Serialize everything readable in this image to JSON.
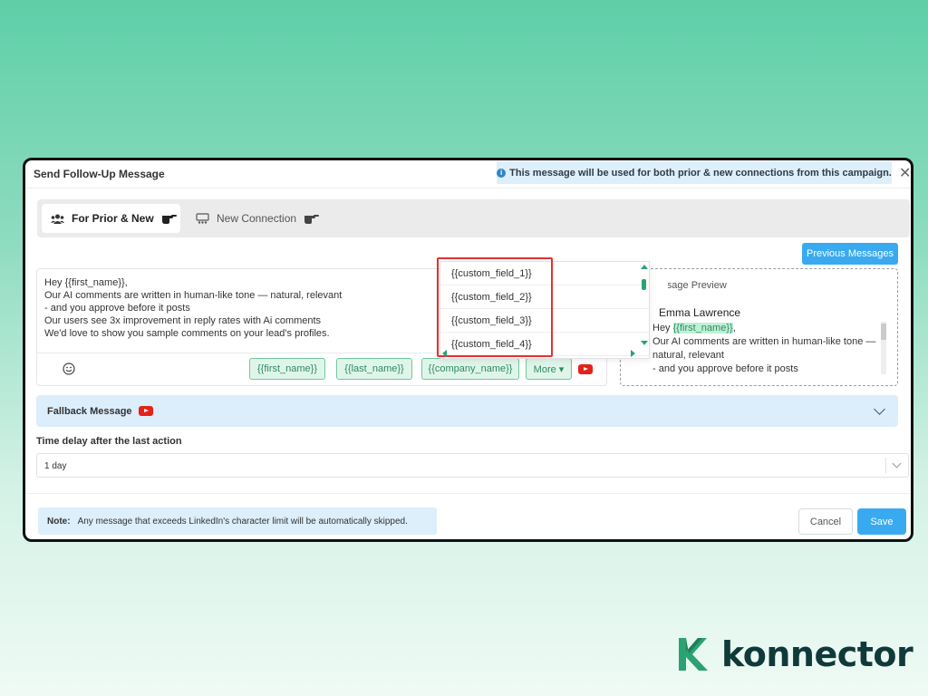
{
  "modal": {
    "title": "Send Follow-Up Message",
    "info_banner": "This message will be used for both prior & new connections from this campaign.",
    "close_label": "✕"
  },
  "tabs": [
    {
      "label": "For Prior & New",
      "active": true,
      "icon": "users-icon"
    },
    {
      "label": "New Connection",
      "active": false,
      "icon": "network-icon"
    }
  ],
  "previous_messages_label": "Previous Messages",
  "editor": {
    "lines": [
      "Hey {{first_name}},",
      "Our AI comments are written in human-like tone — natural, relevant",
      "- and you approve before it posts",
      "Our users see 3x improvement in reply rates with Ai comments",
      "We'd love to show you sample comments on your lead's profiles."
    ],
    "chips": [
      "{{first_name}}",
      "{{last_name}}",
      "{{company_name}}"
    ],
    "more_label": "More ▾"
  },
  "dropdown": {
    "items": [
      "{{custom_field_1}}",
      "{{custom_field_2}}",
      "{{custom_field_3}}",
      "{{custom_field_4}}"
    ]
  },
  "preview": {
    "title": "Message Preview",
    "name": "Emma Lawrence",
    "greeting_prefix": "Hey ",
    "greeting_var": "{{first_name}}",
    "greeting_suffix": ",",
    "body_lines": [
      "Our AI comments are written in human-like tone —",
      "natural, relevant",
      "- and you approve before it posts"
    ]
  },
  "fallback": {
    "label": "Fallback Message"
  },
  "delay": {
    "label": "Time delay after the last action",
    "value": "1 day"
  },
  "note": {
    "prefix": "Note:",
    "text": "Any message that exceeds LinkedIn's character limit will be automatically skipped."
  },
  "buttons": {
    "cancel": "Cancel",
    "save": "Save"
  },
  "brand": {
    "name": "konnector",
    "accent": "#2aa272",
    "primary": "#3aaaf0"
  }
}
